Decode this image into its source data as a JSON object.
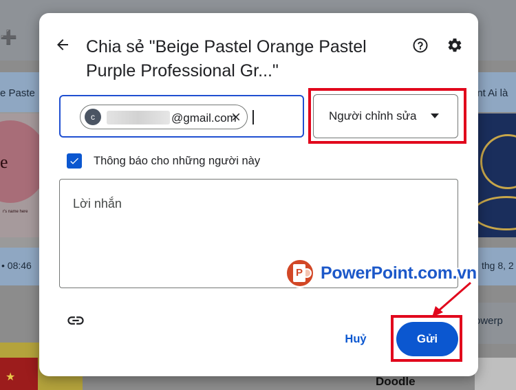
{
  "dialog": {
    "title": "Chia sẻ \"Beige Pastel Orange Pastel Purple Professional Gr...\"",
    "back_icon": "arrow-back-icon",
    "help_icon": "help-circle-icon",
    "settings_icon": "gear-icon"
  },
  "recipient": {
    "avatar_letter": "c",
    "email_suffix": "@gmail.com",
    "remove_icon": "close-icon"
  },
  "role": {
    "selected": "Người chỉnh sửa",
    "icon": "dropdown-arrow-icon"
  },
  "notify": {
    "checked": true,
    "label": "Thông báo cho những người này"
  },
  "message": {
    "placeholder": "Lời nhắn"
  },
  "footer": {
    "link_icon": "link-icon",
    "cancel_label": "Huỷ",
    "send_label": "Gửi"
  },
  "watermark": {
    "text_main": "PowerPoint",
    "text_domain": ".com.vn"
  },
  "background": {
    "left_card_title": "e Paste",
    "left_card_date": "• 08:46",
    "left_thumb_letter": "e",
    "left_thumb_small": "r's name here",
    "right_card_title": "int Ai là",
    "right_card_date": "thg 8, 2",
    "right_lower_title": "owerp",
    "doodle_label": "Doodle"
  },
  "colors": {
    "accent": "#0b57d0",
    "highlight_red": "#e1061c"
  }
}
